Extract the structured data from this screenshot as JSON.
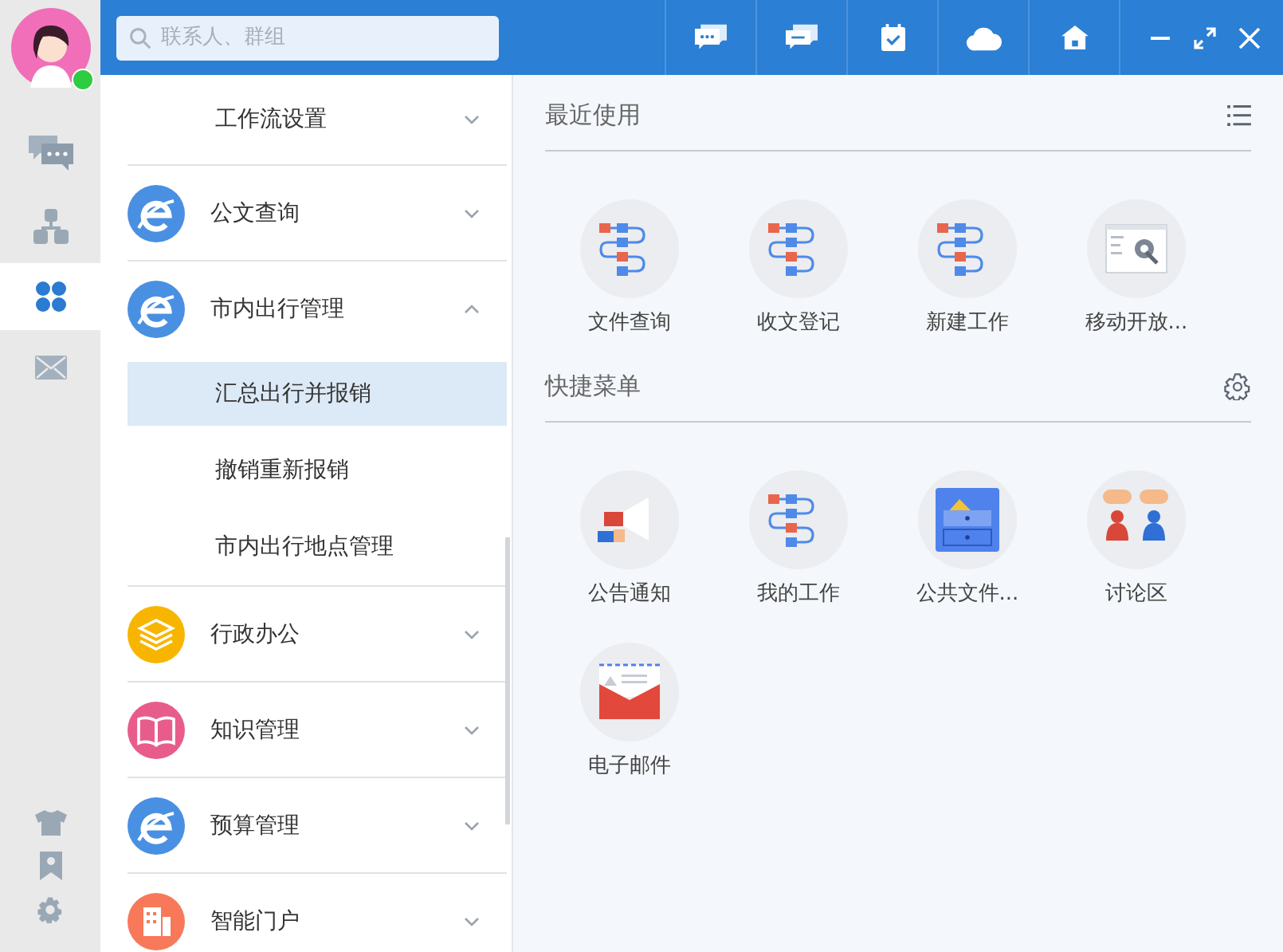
{
  "avatar": {
    "online": true
  },
  "nav_rail": [
    {
      "selected": false
    },
    {
      "selected": false
    },
    {
      "selected": true
    },
    {
      "selected": false
    }
  ],
  "search": {
    "placeholder": "联系人、群组"
  },
  "menu": [
    {
      "kind": "sub",
      "label": "工作流设置",
      "selected": false
    },
    {
      "kind": "group",
      "label": "公文查询",
      "color": "#4a90e2",
      "expanded": false
    },
    {
      "kind": "group",
      "label": "市内出行管理",
      "color": "#4a90e2",
      "expanded": true
    },
    {
      "kind": "sub",
      "label": "汇总出行并报销",
      "selected": true
    },
    {
      "kind": "sub",
      "label": "撤销重新报销",
      "selected": false
    },
    {
      "kind": "sub",
      "label": "市内出行地点管理",
      "selected": false
    },
    {
      "kind": "group",
      "label": "行政办公",
      "color": "#f8b500",
      "expanded": false
    },
    {
      "kind": "group",
      "label": "知识管理",
      "color": "#e85c8c",
      "expanded": false
    },
    {
      "kind": "group",
      "label": "预算管理",
      "color": "#4a90e2",
      "expanded": false
    },
    {
      "kind": "group",
      "label": "智能门户",
      "color": "#f7795a",
      "expanded": false
    }
  ],
  "sections": [
    {
      "title": "最近使用",
      "apps": [
        {
          "label": "文件查询"
        },
        {
          "label": "收文登记"
        },
        {
          "label": "新建工作"
        },
        {
          "label": "移动开放..."
        }
      ]
    },
    {
      "title": "快捷菜单",
      "apps": [
        {
          "label": "公告通知"
        },
        {
          "label": "我的工作"
        },
        {
          "label": "公共文件..."
        },
        {
          "label": "讨论区"
        },
        {
          "label": "电子邮件"
        }
      ]
    }
  ]
}
